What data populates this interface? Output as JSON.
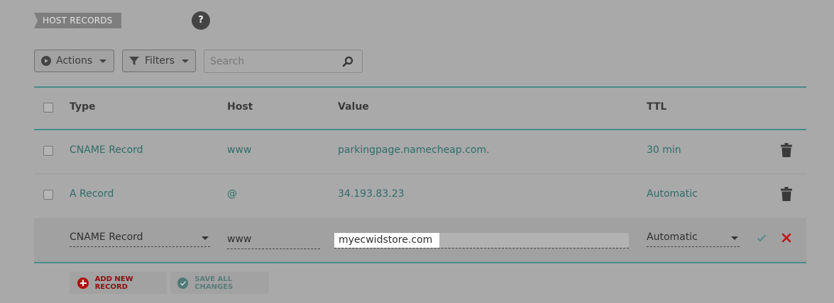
{
  "section": {
    "title": "HOST RECORDS",
    "help_label": "?"
  },
  "toolbar": {
    "actions_label": "Actions",
    "filters_label": "Filters",
    "search_placeholder": "Search"
  },
  "table": {
    "columns": {
      "type": "Type",
      "host": "Host",
      "value": "Value",
      "ttl": "TTL"
    },
    "rows": [
      {
        "type": "CNAME Record",
        "host": "www",
        "value": "parkingpage.namecheap.com.",
        "ttl": "30 min"
      },
      {
        "type": "A Record",
        "host": "@",
        "value": "34.193.83.23",
        "ttl": "Automatic"
      }
    ],
    "edit_row": {
      "type": "CNAME Record",
      "host": "www",
      "value": "myecwidstore.com",
      "ttl": "Automatic"
    }
  },
  "footer": {
    "add_label": "ADD NEW RECORD",
    "save_label": "SAVE ALL CHANGES"
  },
  "colors": {
    "accent_teal": "#4a8a86",
    "link_teal": "#2f6c66",
    "danger_red": "#b01212"
  }
}
